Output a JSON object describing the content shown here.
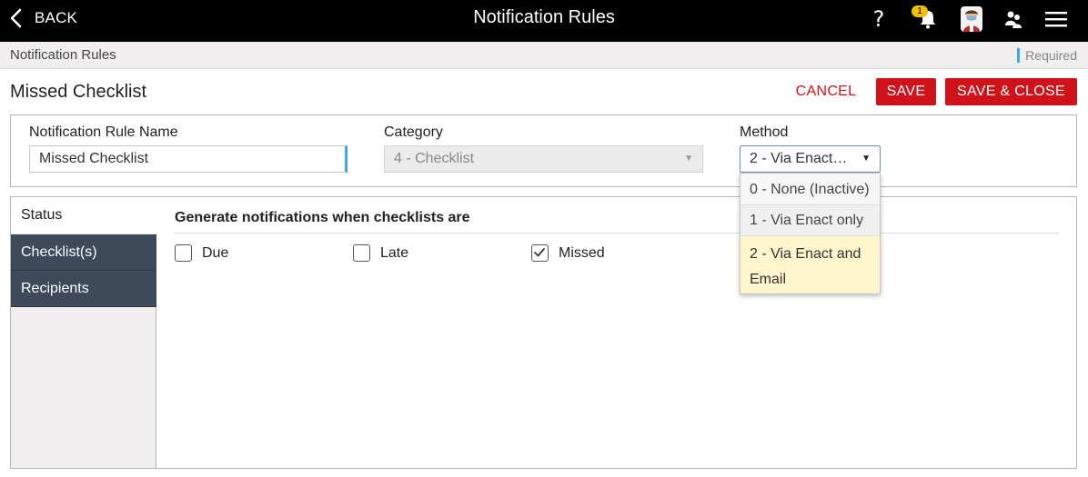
{
  "header": {
    "back_label": "BACK",
    "title": "Notification Rules",
    "help_glyph": "?",
    "notification_count": "1",
    "icons": [
      "back-chevron-icon",
      "help-icon",
      "bell-icon",
      "avatar-icon",
      "people-icon",
      "menu-icon"
    ]
  },
  "breadcrumb": {
    "label": "Notification Rules",
    "required_label": "Required"
  },
  "page": {
    "title": "Missed Checklist"
  },
  "actions": {
    "cancel": "CANCEL",
    "save": "SAVE",
    "save_close": "SAVE & CLOSE"
  },
  "form": {
    "name_label": "Notification Rule Name",
    "name_value": "Missed Checklist",
    "category_label": "Category",
    "category_value": "4 - Checklist",
    "method_label": "Method",
    "method_value": "2 - Via Enact…"
  },
  "method_options": [
    {
      "label": "0 - None (Inactive)"
    },
    {
      "label": "1 - Via Enact only"
    },
    {
      "label": "2 - Via Enact and Email",
      "selected": true
    }
  ],
  "side_tabs": [
    {
      "label": "Status",
      "active": true
    },
    {
      "label": "Checklist(s)"
    },
    {
      "label": "Recipients"
    }
  ],
  "status": {
    "section_title": "Generate notifications when checklists are",
    "options": [
      {
        "label": "Due",
        "checked": false
      },
      {
        "label": "Late",
        "checked": false
      },
      {
        "label": "Missed",
        "checked": true
      }
    ]
  },
  "colors": {
    "accent_red": "#d0121b",
    "required_blue": "#3fa9e0",
    "tab_dark": "#3e4a5a",
    "selected_option": "#fff6cc"
  }
}
